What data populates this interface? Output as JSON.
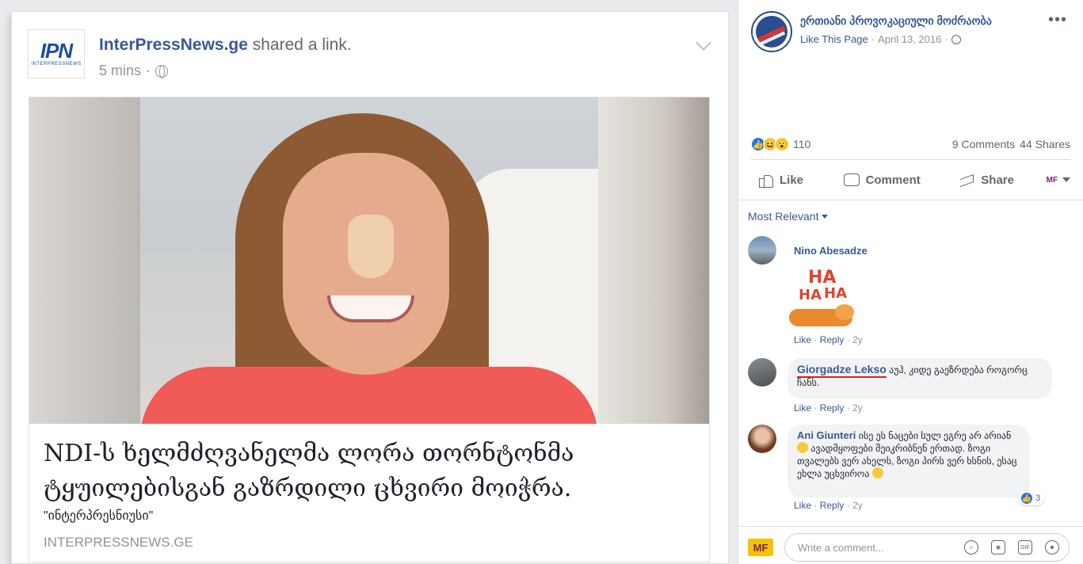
{
  "post": {
    "author": "InterPressNews.ge",
    "action": " shared a link.",
    "time": "5 mins",
    "time_sep": "·",
    "logo_text": "IPN",
    "logo_sub": "INTERPRESSNEWS",
    "link": {
      "title": "NDI-ს ხელმძღვანელმა ლორა თორნტონმა ტყუილებისგან გაზრდილი ცხვირი მოიჭრა.",
      "description": "\"ინტერპრესნიუსი\"",
      "domain": "INTERPRESSNEWS.GE"
    }
  },
  "panel": {
    "page_name": "ერთიანი პროვოკაციული მოძრაობა",
    "like_this_page": "Like This Page",
    "meta_date": "April 13, 2016",
    "meta_sep": "·",
    "more_icon": "more-dots-icon",
    "reaction_count": "110",
    "comments_count": "9 Comments",
    "shares_count": "44 Shares",
    "actions": {
      "like": "Like",
      "comment": "Comment",
      "share": "Share",
      "profile_chip": "MF"
    },
    "sort_label": "Most Relevant",
    "comments": [
      {
        "name": "Nino Abesadze",
        "text": "",
        "sticker_text": [
          "HA",
          "HA",
          "HA"
        ],
        "like": "Like",
        "reply": "Reply",
        "age": "2y"
      },
      {
        "name": "Giorgadze Lekso",
        "text": "აუჰ, კიდე გაეზრდება როგორც ჩანს.",
        "like": "Like",
        "reply": "Reply",
        "age": "2y"
      },
      {
        "name": "Ani Giunteri",
        "text_before": "ისე ეს ნაცები სულ ეგრე არ არიან",
        "text_after": "ავადმყოფები შეიკრიბნენ ერთად. ზოგი თვალებს ვერ ახელს, ზოგი პირს ვერ ხსნის, ესაც ეხლა უცხვიროა",
        "like": "Like",
        "reply": "Reply",
        "age": "2y",
        "likes": "3"
      }
    ],
    "composer": {
      "avatar_text": "MF",
      "placeholder": "Write a comment...",
      "icons": [
        "emoji-icon",
        "camera-icon",
        "gif-icon",
        "sticker-icon"
      ]
    }
  },
  "colors": {
    "link_blue": "#385898",
    "like_blue": "#1877f2",
    "meta_gray": "#90949c"
  }
}
